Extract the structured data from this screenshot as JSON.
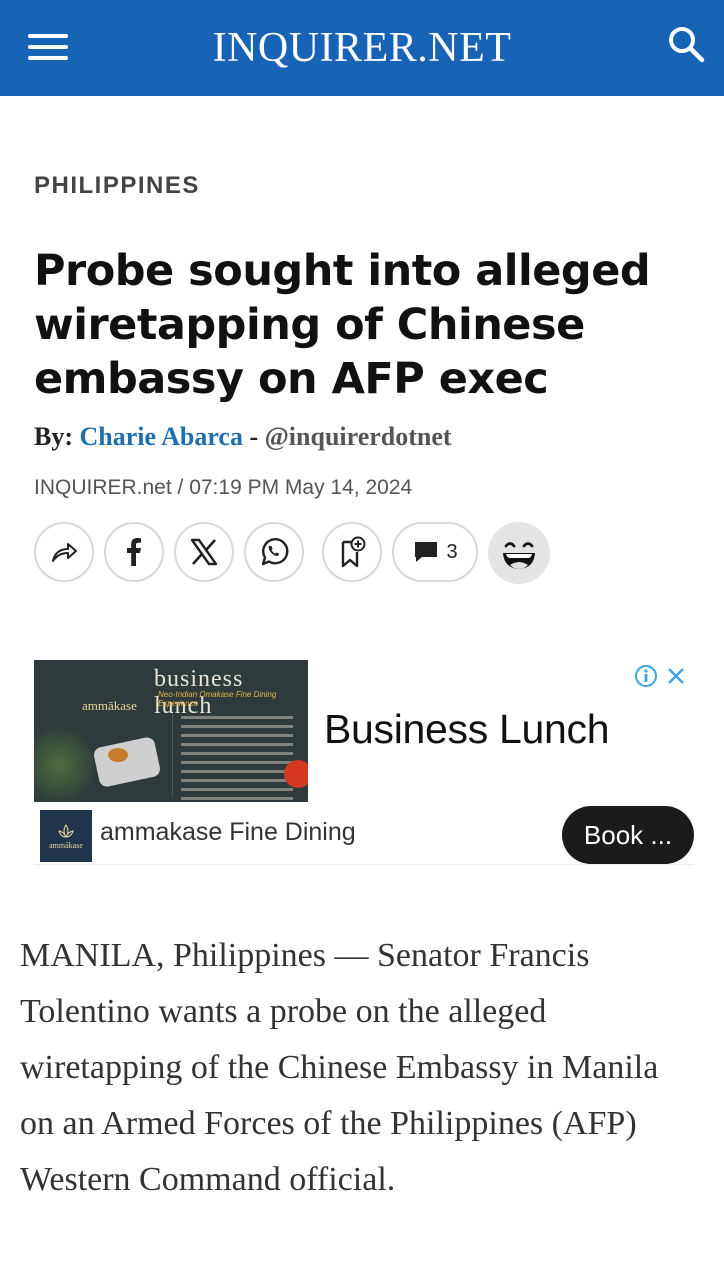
{
  "header": {
    "logo": "INQUIRER.NET"
  },
  "article": {
    "section": "PHILIPPINES",
    "headline": "Probe sought into alleged wiretapping of Chinese embassy on AFP exec",
    "byline_prefix": "By: ",
    "author": "Charie Abarca",
    "byline_sep": " - ",
    "handle": "@inquirerdotnet",
    "dateline": "INQUIRER.net / 07:19 PM May 14, 2024",
    "body": "MANILA, Philippines — Senator Francis Tolentino wants a probe on the alleged wiretapping of the Chinese Embassy in Manila on an Armed Forces of the Philippines (AFP) Western Command official."
  },
  "share": {
    "comment_count": "3"
  },
  "ad": {
    "image_title": "business lunch",
    "image_brand": "ammākase",
    "image_tagline": "Neo-Indian Omakase Fine Dining Experience",
    "headline": "Business Lunch",
    "advertiser": "ammakase Fine Dining",
    "logo_text": "ammākase",
    "cta": "Book ..."
  },
  "colors": {
    "brand_blue": "#1763b5",
    "author_link": "#1f6fb0",
    "ad_choices": "#3aa5d8"
  }
}
